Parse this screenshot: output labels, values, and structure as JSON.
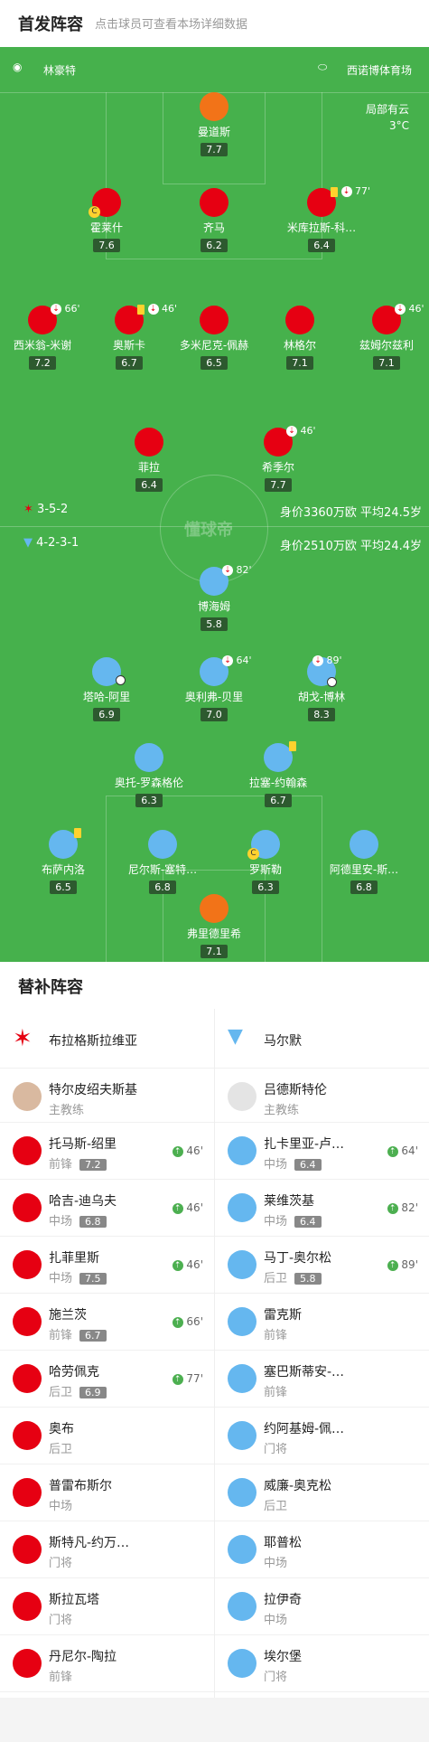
{
  "header": {
    "title": "首发阵容",
    "subtitle": "点击球员可查看本场详细数据"
  },
  "pitch": {
    "home_coach": "林豪特",
    "venue": "西诺博体育场",
    "weather": "局部有云",
    "temp": "3°C",
    "home_formation": "3-5-2",
    "home_value": "身价3360万欧  平均24.5岁",
    "away_formation": "4-2-3-1",
    "away_value": "身价2510万欧  平均24.4岁",
    "watermark": "懂球帝"
  },
  "home_players": [
    {
      "name": "曼道斯",
      "rating": "7.7",
      "color": "orange"
    },
    {
      "name": "霍莱什",
      "rating": "7.6",
      "color": "red",
      "captain": "C"
    },
    {
      "name": "齐马",
      "rating": "6.2",
      "color": "red"
    },
    {
      "name": "米库拉斯-科…",
      "rating": "6.4",
      "color": "red",
      "minute": "77'"
    },
    {
      "name": "西米翁-米谢",
      "rating": "7.2",
      "color": "red",
      "minute": "66'"
    },
    {
      "name": "奥斯卡",
      "rating": "6.7",
      "color": "red",
      "minute": "46'"
    },
    {
      "name": "多米尼克-佩赫",
      "rating": "6.5",
      "color": "red"
    },
    {
      "name": "林格尔",
      "rating": "7.1",
      "color": "red"
    },
    {
      "name": "兹姆尔兹利",
      "rating": "7.1",
      "color": "red",
      "minute": "46'"
    },
    {
      "name": "菲拉",
      "rating": "6.4",
      "color": "red"
    },
    {
      "name": "希季尔",
      "rating": "7.7",
      "color": "red",
      "minute": "46'"
    }
  ],
  "away_players": [
    {
      "name": "博海姆",
      "rating": "5.8",
      "minute": "82'"
    },
    {
      "name": "塔哈-阿里",
      "rating": "6.9"
    },
    {
      "name": "奥利弗-贝里",
      "rating": "7.0",
      "minute": "64'"
    },
    {
      "name": "胡戈-博林",
      "rating": "8.3",
      "minute": "89'"
    },
    {
      "name": "奥托-罗森格伦",
      "rating": "6.3"
    },
    {
      "name": "拉塞-约翰森",
      "rating": "6.7"
    },
    {
      "name": "布萨内洛",
      "rating": "6.5"
    },
    {
      "name": "尼尔斯-塞特…",
      "rating": "6.8"
    },
    {
      "name": "罗斯勒",
      "rating": "6.3",
      "captain": "C"
    },
    {
      "name": "阿德里安-斯…",
      "rating": "6.8"
    },
    {
      "name": "弗里德里希",
      "rating": "7.1"
    }
  ],
  "subs": {
    "title": "替补阵容",
    "home_team": "布拉格斯拉维亚",
    "away_team": "马尔默",
    "home_coach": "特尔皮绍夫斯基",
    "away_coach": "吕德斯特伦",
    "coach_label": "主教练",
    "home": [
      {
        "name": "托马斯-绍里",
        "pos": "前锋",
        "rating": "7.2",
        "minute": "46'"
      },
      {
        "name": "哈吉-迪乌夫",
        "pos": "中场",
        "rating": "6.8",
        "minute": "46'"
      },
      {
        "name": "扎菲里斯",
        "pos": "中场",
        "rating": "7.5",
        "minute": "46'"
      },
      {
        "name": "施兰茨",
        "pos": "前锋",
        "rating": "6.7",
        "minute": "66'"
      },
      {
        "name": "哈劳佩克",
        "pos": "后卫",
        "rating": "6.9",
        "minute": "77'"
      },
      {
        "name": "奥布",
        "pos": "后卫"
      },
      {
        "name": "普雷布斯尔",
        "pos": "中场"
      },
      {
        "name": "斯特凡-约万…",
        "pos": "门将"
      },
      {
        "name": "斯拉瓦塔",
        "pos": "门将"
      },
      {
        "name": "丹尼尔-陶拉",
        "pos": "前锋"
      }
    ],
    "away": [
      {
        "name": "扎卡里亚-卢…",
        "pos": "中场",
        "rating": "6.4",
        "minute": "64'"
      },
      {
        "name": "莱维茨基",
        "pos": "中场",
        "rating": "6.4",
        "minute": "82'"
      },
      {
        "name": "马丁-奥尔松",
        "pos": "后卫",
        "rating": "5.8",
        "minute": "89'"
      },
      {
        "name": "雷克斯",
        "pos": "前锋"
      },
      {
        "name": "塞巴斯蒂安-…",
        "pos": "前锋"
      },
      {
        "name": "约阿基姆-佩…",
        "pos": "门将"
      },
      {
        "name": "威廉-奥克松",
        "pos": "后卫"
      },
      {
        "name": "耶普松",
        "pos": "中场"
      },
      {
        "name": "拉伊奇",
        "pos": "中场"
      },
      {
        "name": "埃尔堡",
        "pos": "门将"
      }
    ]
  }
}
